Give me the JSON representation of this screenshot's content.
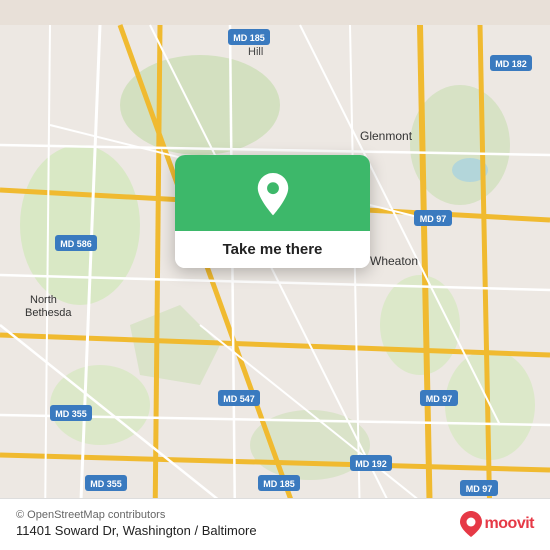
{
  "map": {
    "background_color": "#e8e0d8",
    "center_lat": 39.05,
    "center_lng": -77.05
  },
  "popup": {
    "button_label": "Take me there",
    "icon": "location-pin"
  },
  "bottom_bar": {
    "copyright": "© OpenStreetMap contributors",
    "address": "11401 Soward Dr, Washington / Baltimore",
    "logo_text": "moovit"
  },
  "road_labels": [
    "MD 586",
    "MD 185",
    "MD 182",
    "MD 97",
    "MD 355",
    "MD 547",
    "MD 192",
    "MD 185"
  ],
  "place_labels": [
    "North Bethesda",
    "Glenmont",
    "Wheaton",
    "Hill"
  ]
}
